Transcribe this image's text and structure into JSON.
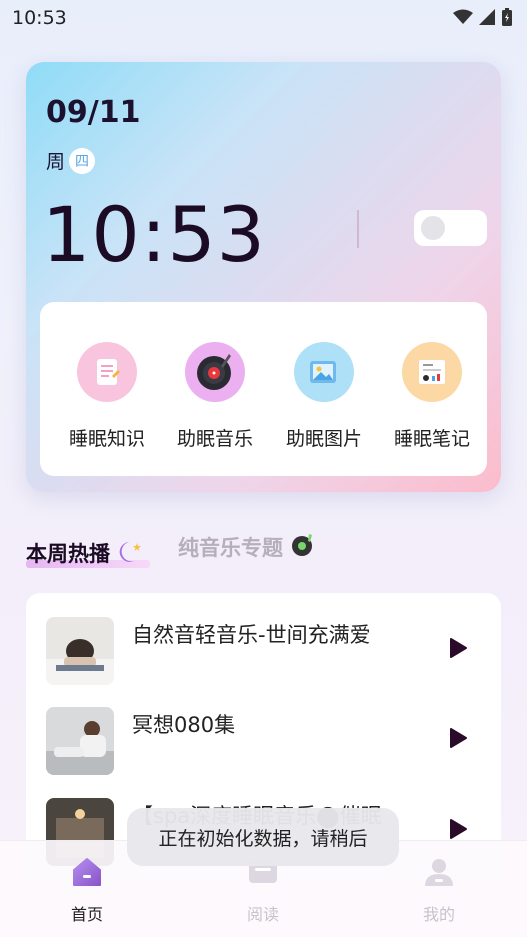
{
  "status_bar": {
    "time": "10:53"
  },
  "clock": {
    "date": "09/11",
    "weekday_prefix": "周",
    "weekday_badge": "四",
    "time": "10:53",
    "toggle_on": false
  },
  "tools": [
    {
      "label": "睡眠知识",
      "icon": "document-icon",
      "color": "#f9c4de"
    },
    {
      "label": "助眠音乐",
      "icon": "vinyl-record-icon",
      "color": "#ecaff0"
    },
    {
      "label": "助眠图片",
      "icon": "picture-icon",
      "color": "#aee0f7"
    },
    {
      "label": "睡眠笔记",
      "icon": "notebook-icon",
      "color": "#fbd8a4"
    }
  ],
  "tabs": {
    "hot": "本周热播",
    "music": "纯音乐专题"
  },
  "songs": [
    {
      "title": "自然音轻音乐-世间充满爱"
    },
    {
      "title": "冥想080集"
    },
    {
      "title": "【spa深度睡眠音乐⬤催眠"
    }
  ],
  "toast": "正在初始化数据，请稍后",
  "nav": [
    {
      "label": "首页",
      "icon": "home-icon",
      "active": true
    },
    {
      "label": "阅读",
      "icon": "reading-icon",
      "active": false
    },
    {
      "label": "我的",
      "icon": "profile-icon",
      "active": false
    }
  ],
  "colors": {
    "accent": "#8a55c8",
    "inactive": "#cfc9d4"
  }
}
